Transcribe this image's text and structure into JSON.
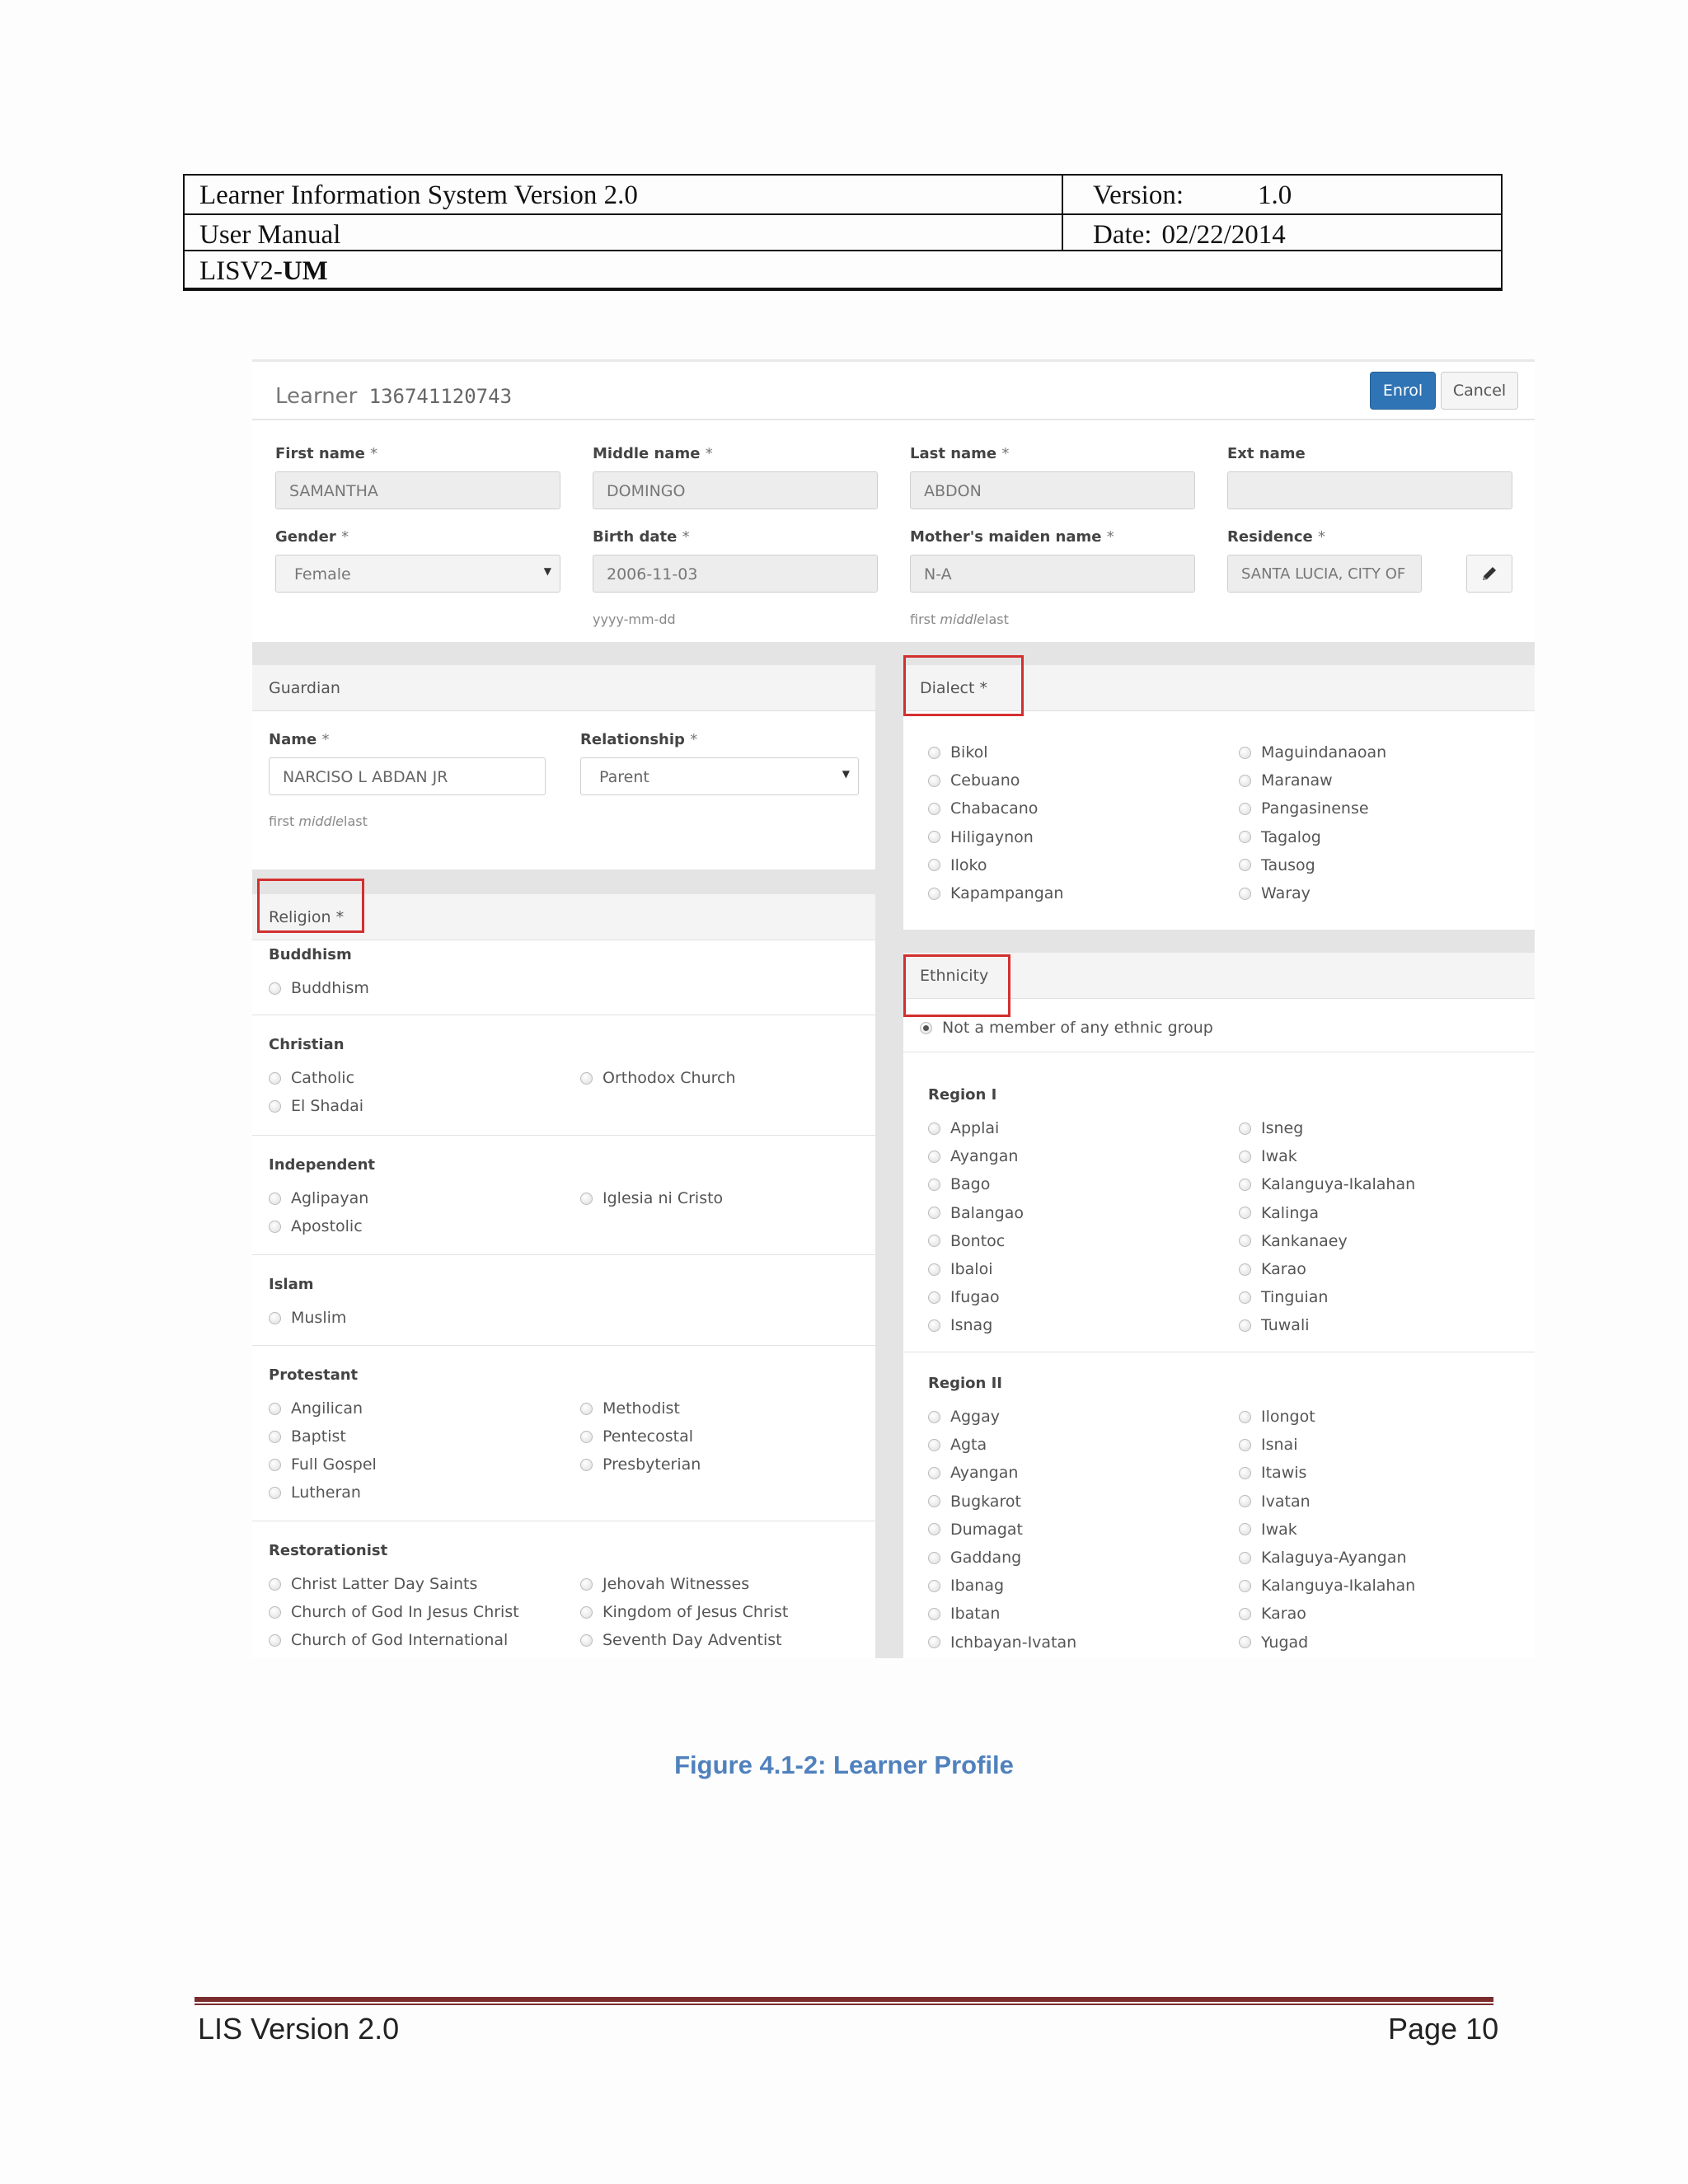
{
  "doc_header": {
    "system_title": "Learner Information System Version 2.0",
    "version_label": "Version:",
    "version_value": "1.0",
    "manual_label": "User Manual",
    "date_label": "Date:",
    "date_value": "02/22/2014",
    "doc_code_prefix": "LISV2-",
    "doc_code_suffix": "UM"
  },
  "form": {
    "title": "Learner",
    "learner_id": "136741120743",
    "enrol_label": "Enrol",
    "cancel_label": "Cancel",
    "first_name": {
      "label": "First name",
      "value": "SAMANTHA"
    },
    "middle_name": {
      "label": "Middle name",
      "value": "DOMINGO"
    },
    "last_name": {
      "label": "Last name",
      "value": "ABDON"
    },
    "ext_name": {
      "label": "Ext name",
      "value": ""
    },
    "gender": {
      "label": "Gender",
      "value": "Female"
    },
    "birth_date": {
      "label": "Birth date",
      "value": "2006-11-03",
      "hint": "yyyy-mm-dd"
    },
    "mothers_maiden": {
      "label": "Mother's maiden name",
      "value": "N-A",
      "hint_first": "first",
      "hint_middle": "middle",
      "hint_last": "last"
    },
    "residence": {
      "label": "Residence",
      "value": "SANTA LUCIA, CITY OF"
    },
    "required_mark": "*"
  },
  "guardian": {
    "title": "Guardian",
    "name_label": "Name",
    "name_value": "NARCISO L  ABDAN JR",
    "relationship_label": "Relationship",
    "relationship_value": "Parent",
    "hint_first": "first",
    "hint_middle": "middle",
    "hint_last": "last"
  },
  "religion": {
    "title": "Religion",
    "groups": [
      {
        "name": "Buddhism",
        "left": [
          "Buddhism"
        ],
        "right": []
      },
      {
        "name": "Christian",
        "left": [
          "Catholic",
          "El Shadai"
        ],
        "right": [
          "Orthodox Church"
        ]
      },
      {
        "name": "Independent",
        "left": [
          "Aglipayan",
          "Apostolic"
        ],
        "right": [
          "Iglesia ni Cristo"
        ]
      },
      {
        "name": "Islam",
        "left": [
          "Muslim"
        ],
        "right": []
      },
      {
        "name": "Protestant",
        "left": [
          "Angilican",
          "Baptist",
          "Full Gospel",
          "Lutheran"
        ],
        "right": [
          "Methodist",
          "Pentecostal",
          "Presbyterian"
        ]
      },
      {
        "name": "Restorationist",
        "left": [
          "Christ Latter Day Saints",
          "Church of God In Jesus Christ",
          "Church of God International"
        ],
        "right": [
          "Jehovah Witnesses",
          "Kingdom of Jesus Christ",
          "Seventh Day Adventist"
        ]
      }
    ]
  },
  "dialect": {
    "title": "Dialect",
    "left": [
      "Bikol",
      "Cebuano",
      "Chabacano",
      "Hiligaynon",
      "Iloko",
      "Kapampangan"
    ],
    "right": [
      "Maguindanaoan",
      "Maranaw",
      "Pangasinense",
      "Tagalog",
      "Tausog",
      "Waray"
    ]
  },
  "ethnicity": {
    "title": "Ethnicity",
    "not_member": "Not a member of any ethnic group",
    "regions": [
      {
        "name": "Region I",
        "left": [
          "Applai",
          "Ayangan",
          "Bago",
          "Balangao",
          "Bontoc",
          "Ibaloi",
          "Ifugao",
          "Isnag"
        ],
        "right": [
          "Isneg",
          "Iwak",
          "Kalanguya-Ikalahan",
          "Kalinga",
          "Kankanaey",
          "Karao",
          "Tinguian",
          "Tuwali"
        ]
      },
      {
        "name": "Region II",
        "left": [
          "Aggay",
          "Agta",
          "Ayangan",
          "Bugkarot",
          "Dumagat",
          "Gaddang",
          "Ibanag",
          "Ibatan",
          "Ichbayan-Ivatan"
        ],
        "right": [
          "Ilongot",
          "Isnai",
          "Itawis",
          "Ivatan",
          "Iwak",
          "Kalaguya-Ayangan",
          "Kalanguya-Ikalahan",
          "Karao",
          "Yugad"
        ]
      }
    ]
  },
  "caption": "Figure 4.1-2: Learner Profile",
  "footer": {
    "left": "LIS Version 2.0",
    "right": "Page 10"
  }
}
